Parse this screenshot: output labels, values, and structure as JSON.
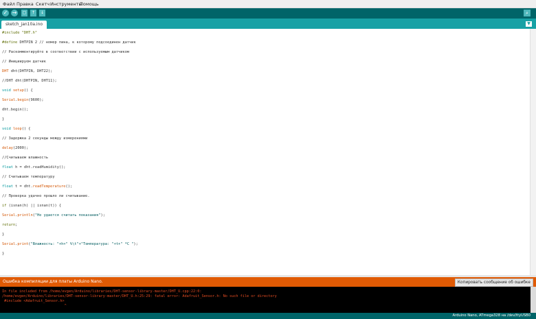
{
  "menu": [
    "Файл",
    "Правка",
    "Скетч",
    "Инструменты",
    "Помощь"
  ],
  "tab": {
    "label": "sketch_jan10a.ino",
    "menu_glyph": "▼"
  },
  "toolbar": {
    "verify": "✓",
    "upload": "→",
    "new": "▢",
    "open": "↑",
    "save": "↓",
    "serial": "⌕"
  },
  "code": [
    [
      {
        "t": "#include \"DHT.h\"",
        "c": "k"
      }
    ],
    [
      {
        "t": "#define ",
        "c": "k"
      },
      {
        "t": "DHTPIN 2 // номер пина, к которому подсоединен датчик",
        "c": ""
      }
    ],
    [
      {
        "t": "// Раскомментируйте в соответствии с используемым датчиком",
        "c": ""
      }
    ],
    [
      {
        "t": "// Инициируем датчик",
        "c": ""
      }
    ],
    [
      {
        "t": "DHT",
        "c": "f"
      },
      {
        "t": " dht(DHTPIN, DHT22);",
        "c": ""
      }
    ],
    [
      {
        "t": "//DHT dht(DHTPIN, DHT11);",
        "c": ""
      }
    ],
    [
      {
        "t": "void",
        "c": "t"
      },
      {
        "t": " ",
        "c": ""
      },
      {
        "t": "setup",
        "c": "f"
      },
      {
        "t": "() {",
        "c": ""
      }
    ],
    [
      {
        "t": "Serial",
        "c": "f"
      },
      {
        "t": ".",
        "c": ""
      },
      {
        "t": "begin",
        "c": "f"
      },
      {
        "t": "(9600);",
        "c": ""
      }
    ],
    [
      {
        "t": "dht.begin();",
        "c": ""
      }
    ],
    [
      {
        "t": "}",
        "c": ""
      }
    ],
    [
      {
        "t": "void",
        "c": "t"
      },
      {
        "t": " ",
        "c": ""
      },
      {
        "t": "loop",
        "c": "f"
      },
      {
        "t": "() {",
        "c": ""
      }
    ],
    [
      {
        "t": "// Задержка 2 секунды между измерениями",
        "c": ""
      }
    ],
    [
      {
        "t": "delay",
        "c": "f"
      },
      {
        "t": "(2000);",
        "c": ""
      }
    ],
    [
      {
        "t": "//Считываем влажность",
        "c": ""
      }
    ],
    [
      {
        "t": "float",
        "c": "t"
      },
      {
        "t": " h = dht.readHumidity();",
        "c": ""
      }
    ],
    [
      {
        "t": "// Считываем температуру",
        "c": ""
      }
    ],
    [
      {
        "t": "float",
        "c": "t"
      },
      {
        "t": " t = dht.",
        "c": ""
      },
      {
        "t": "readTemperature",
        "c": "f"
      },
      {
        "t": "();",
        "c": ""
      }
    ],
    [
      {
        "t": "// Проверка удачно прошло ли считывание.",
        "c": ""
      }
    ],
    [
      {
        "t": "if",
        "c": "k"
      },
      {
        "t": " (isnan(h) || isnan(t)) {",
        "c": ""
      }
    ],
    [
      {
        "t": "Serial",
        "c": "f"
      },
      {
        "t": ".",
        "c": ""
      },
      {
        "t": "println",
        "c": "f"
      },
      {
        "t": "(",
        "c": ""
      },
      {
        "t": "\"Не удается считать показания\"",
        "c": "s"
      },
      {
        "t": ");",
        "c": ""
      }
    ],
    [
      {
        "t": "return",
        "c": "k"
      },
      {
        "t": ";",
        "c": ""
      }
    ],
    [
      {
        "t": "}",
        "c": ""
      }
    ],
    [
      {
        "t": "Serial",
        "c": "f"
      },
      {
        "t": ".",
        "c": ""
      },
      {
        "t": "print",
        "c": "f"
      },
      {
        "t": "(",
        "c": ""
      },
      {
        "t": "\"Влажность: \"+h+\" %\\t\"+\"Температура: \"+t+\" *C \"",
        "c": "s"
      },
      {
        "t": ");",
        "c": ""
      }
    ],
    [
      {
        "t": "}",
        "c": ""
      }
    ]
  ],
  "error_bar": {
    "title": "Ошибка компиляции для платы Arduino Nano.",
    "copy_button": "Копировать сообщение об ошибке"
  },
  "console": [
    "In file included from /home/evgen/Arduino/libraries/DHT-sensor-library-master/DHT_U.cpp:22:0:",
    "/home/evgen/Arduino/libraries/DHT-sensor-library-master/DHT_U.h:25:29: fatal error: Adafruit_Sensor.h: No such file or directory",
    " #include <Adafruit_Sensor.h>",
    "                             ^"
  ],
  "status": "Arduino Nano, ATmega328 на /dev/ttyUSB0"
}
